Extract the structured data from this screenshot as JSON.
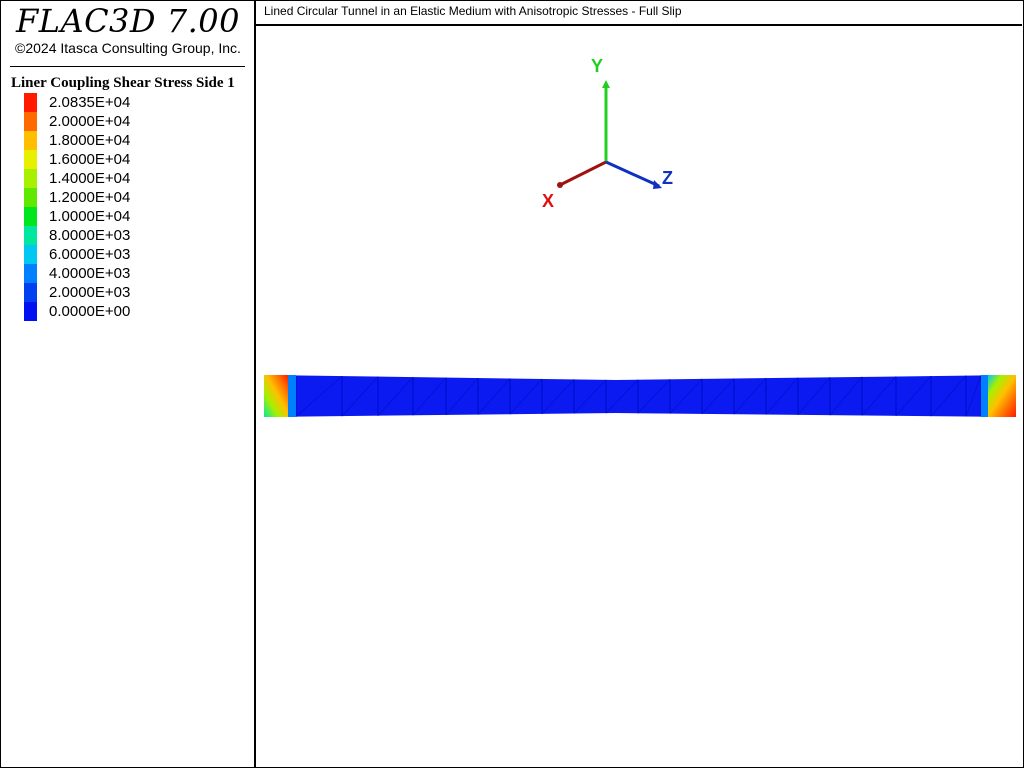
{
  "app": {
    "title": "FLAC3D 7.00",
    "copyright": "©2024 Itasca Consulting Group, Inc."
  },
  "plot": {
    "title": "Lined Circular Tunnel in an Elastic Medium with Anisotropic Stresses - Full Slip"
  },
  "legend": {
    "title": "Liner Coupling Shear Stress Side 1",
    "items": [
      {
        "label": "2.0835E+04",
        "color": "#ff1a00"
      },
      {
        "label": "2.0000E+04",
        "color": "#ff6a00"
      },
      {
        "label": "1.8000E+04",
        "color": "#ffbf00"
      },
      {
        "label": "1.6000E+04",
        "color": "#e6f000"
      },
      {
        "label": "1.4000E+04",
        "color": "#a6f000"
      },
      {
        "label": "1.2000E+04",
        "color": "#5fe800"
      },
      {
        "label": "1.0000E+04",
        "color": "#00e61e"
      },
      {
        "label": "8.0000E+03",
        "color": "#00e8a0"
      },
      {
        "label": "6.0000E+03",
        "color": "#00c8f0"
      },
      {
        "label": "4.0000E+03",
        "color": "#0080ff"
      },
      {
        "label": "2.0000E+03",
        "color": "#0040f0"
      },
      {
        "label": "0.0000E+00",
        "color": "#0010f0"
      }
    ]
  },
  "axes": {
    "y_label": "Y",
    "x_label": "X",
    "z_label": "Z",
    "y_color": "#20d020",
    "x_color": "#e01010",
    "z_color": "#1030c0"
  },
  "liner": {
    "main_color": "#0a1af0"
  }
}
